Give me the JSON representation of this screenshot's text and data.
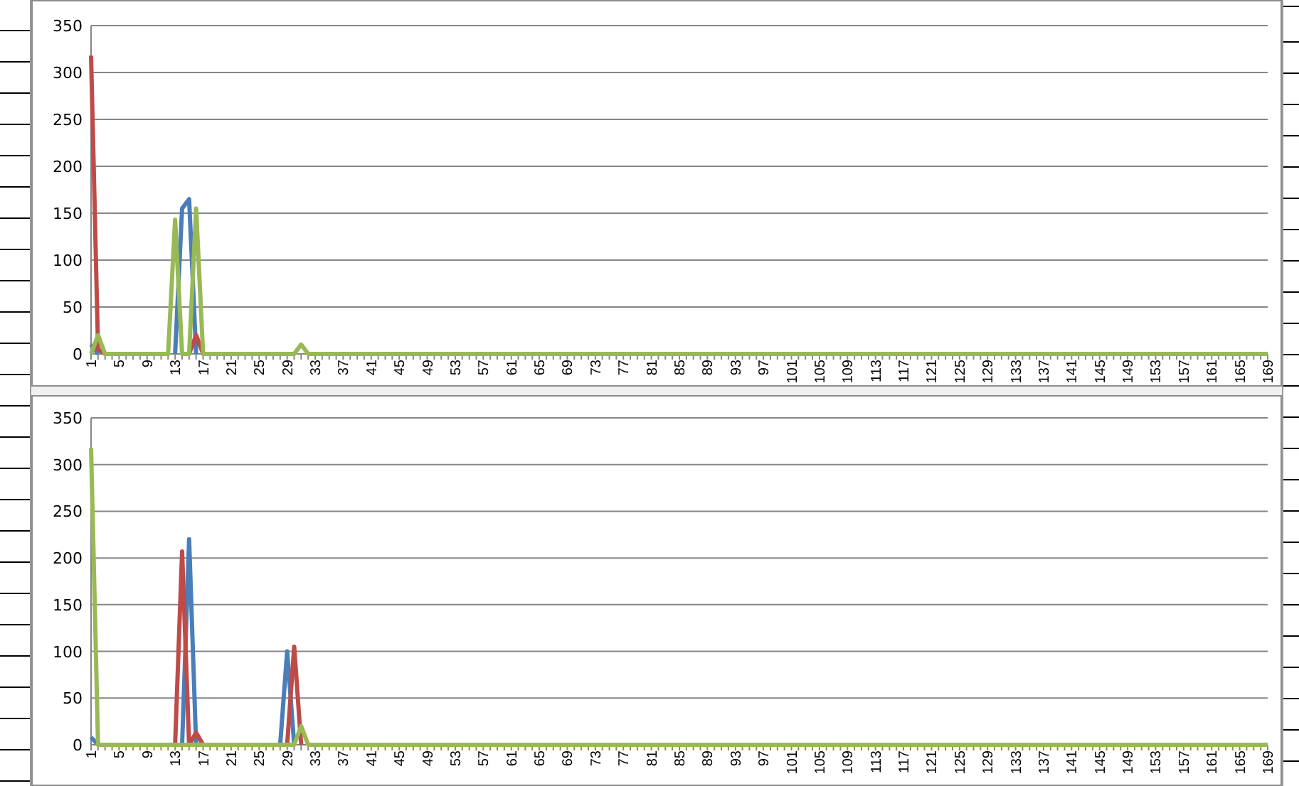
{
  "charts": [
    {
      "chart_data": {
        "type": "line",
        "x": [
          1,
          2,
          3,
          4,
          5,
          6,
          7,
          8,
          9,
          10,
          11,
          12,
          13,
          14,
          15,
          16,
          17,
          18,
          19,
          20,
          21,
          22,
          23,
          24,
          25,
          26,
          27,
          28,
          29,
          30,
          31,
          32,
          33,
          34,
          35,
          36,
          37,
          38,
          39,
          40,
          41,
          42,
          43,
          44,
          45,
          46,
          47,
          48,
          49,
          50,
          51,
          52,
          53,
          54,
          55,
          56,
          57,
          58,
          59,
          60,
          61,
          62,
          63,
          64,
          65,
          66,
          67,
          68,
          69,
          70,
          71,
          72,
          73,
          74,
          75,
          76,
          77,
          78,
          79,
          80,
          81,
          82,
          83,
          84,
          85,
          86,
          87,
          88,
          89,
          90,
          91,
          92,
          93,
          94,
          95,
          96,
          97,
          98,
          99,
          100,
          101,
          102,
          103,
          104,
          105,
          106,
          107,
          108,
          109,
          110,
          111,
          112,
          113,
          114,
          115,
          116,
          117,
          118,
          119,
          120,
          121,
          122,
          123,
          124,
          125,
          126,
          127,
          128,
          129,
          130,
          131,
          132,
          133,
          134,
          135,
          136,
          137,
          138,
          139,
          140,
          141,
          142,
          143,
          144,
          145,
          146,
          147,
          148,
          149,
          150,
          151,
          152,
          153,
          154,
          155,
          156,
          157,
          158,
          159,
          160,
          161,
          162,
          163,
          164,
          165,
          166,
          167,
          168,
          169
        ],
        "xlim": [
          1,
          169
        ],
        "xticks": [
          1,
          5,
          9,
          13,
          17,
          21,
          25,
          29,
          33,
          37,
          41,
          45,
          49,
          53,
          57,
          61,
          65,
          69,
          73,
          77,
          81,
          85,
          89,
          93,
          97,
          101,
          105,
          109,
          113,
          117,
          121,
          125,
          129,
          133,
          137,
          141,
          145,
          149,
          153,
          157,
          161,
          165,
          169
        ],
        "ylim": [
          0,
          350
        ],
        "yticks": [
          0,
          50,
          100,
          150,
          200,
          250,
          300,
          350
        ],
        "grid": true,
        "series": [
          {
            "color": "#4a7ebb",
            "values": [
              10,
              0,
              null,
              null,
              null,
              null,
              null,
              null,
              null,
              null,
              null,
              null,
              0,
              155,
              165,
              0,
              null,
              null,
              null,
              null,
              null,
              null,
              null,
              null,
              null,
              null,
              null,
              null,
              null,
              null,
              null,
              null,
              null,
              null,
              null,
              null,
              null,
              null,
              null,
              null,
              null,
              null,
              null,
              null,
              null,
              null,
              null,
              null,
              null,
              null,
              null,
              null,
              null,
              null,
              null,
              null,
              null,
              null,
              null,
              null,
              null,
              null,
              null,
              null,
              null,
              null,
              null,
              null,
              null,
              null,
              null,
              null,
              null,
              null,
              null,
              null,
              null,
              null,
              null,
              null,
              null,
              null,
              null,
              null,
              null,
              null,
              null,
              null,
              null,
              null,
              null,
              null,
              null,
              null,
              null,
              null,
              null,
              null,
              null,
              null,
              null,
              null,
              null,
              null,
              null,
              null,
              null,
              null,
              null,
              null,
              null,
              null,
              null,
              null,
              null,
              null,
              null,
              null,
              null,
              null,
              null,
              null,
              null,
              null,
              null,
              null,
              null,
              null,
              null,
              null,
              null,
              null,
              null,
              null,
              null,
              null,
              null,
              null,
              null,
              null,
              null,
              null,
              null,
              null,
              null,
              null,
              null,
              null,
              null,
              null,
              null,
              null,
              null,
              null,
              null,
              null,
              null,
              null,
              null,
              null,
              null,
              null,
              null,
              null,
              null,
              null,
              null,
              null,
              null
            ]
          },
          {
            "color": "#be4b48",
            "values": [
              318,
              5,
              0,
              null,
              null,
              null,
              null,
              null,
              null,
              null,
              null,
              null,
              null,
              null,
              0,
              20,
              0,
              null,
              null,
              null,
              null,
              null,
              null,
              null,
              null,
              null,
              null,
              null,
              null,
              null,
              null,
              null,
              null,
              null,
              null,
              null,
              null,
              null,
              null,
              null,
              null,
              null,
              null,
              null,
              null,
              null,
              null,
              null,
              null,
              null,
              null,
              null,
              null,
              null,
              null,
              null,
              null,
              null,
              null,
              null,
              null,
              null,
              null,
              null,
              null,
              null,
              null,
              null,
              null,
              null,
              null,
              null,
              null,
              null,
              null,
              null,
              null,
              null,
              null,
              null,
              null,
              null,
              null,
              null,
              null,
              null,
              null,
              null,
              null,
              null,
              null,
              null,
              null,
              null,
              null,
              null,
              null,
              null,
              null,
              null,
              null,
              null,
              null,
              null,
              null,
              null,
              null,
              null,
              null,
              null,
              null,
              null,
              null,
              null,
              null,
              null,
              null,
              null,
              null,
              null,
              null,
              null,
              null,
              null,
              null,
              null,
              null,
              null,
              null,
              null,
              null,
              null,
              null,
              null,
              null,
              null,
              null,
              null,
              null,
              null,
              null,
              null,
              null,
              null,
              null,
              null,
              null,
              null,
              null,
              null,
              null,
              null,
              null,
              null,
              null,
              null,
              null,
              null,
              null,
              null,
              null,
              null,
              null,
              null,
              null,
              null,
              null,
              null,
              null
            ]
          },
          {
            "color": "#98b954",
            "values": [
              0,
              20,
              0,
              0,
              0,
              0,
              0,
              0,
              0,
              0,
              0,
              0,
              143,
              0,
              0,
              155,
              0,
              0,
              0,
              0,
              0,
              0,
              0,
              0,
              0,
              0,
              0,
              0,
              0,
              0,
              10,
              0,
              0,
              0,
              0,
              0,
              0,
              0,
              0,
              0,
              0,
              0,
              0,
              0,
              0,
              0,
              0,
              0,
              0,
              0,
              0,
              0,
              0,
              0,
              0,
              0,
              0,
              0,
              0,
              0,
              0,
              0,
              0,
              0,
              0,
              0,
              0,
              0,
              0,
              0,
              0,
              0,
              0,
              0,
              0,
              0,
              0,
              0,
              0,
              0,
              0,
              0,
              0,
              0,
              0,
              0,
              0,
              0,
              0,
              0,
              0,
              0,
              0,
              0,
              0,
              0,
              0,
              0,
              0,
              0,
              0,
              0,
              0,
              0,
              0,
              0,
              0,
              0,
              0,
              0,
              0,
              0,
              0,
              0,
              0,
              0,
              0,
              0,
              0,
              0,
              0,
              0,
              0,
              0,
              0,
              0,
              0,
              0,
              0,
              0,
              0,
              0,
              0,
              0,
              0,
              0,
              0,
              0,
              0,
              0,
              0,
              0,
              0,
              0,
              0,
              0,
              0,
              0,
              0,
              0,
              0,
              0,
              0,
              0,
              0,
              0,
              0,
              0,
              0,
              0,
              0,
              0,
              0,
              0,
              0,
              0,
              0,
              0,
              0
            ]
          }
        ]
      }
    },
    {
      "chart_data": {
        "type": "line",
        "x": [
          1,
          2,
          3,
          4,
          5,
          6,
          7,
          8,
          9,
          10,
          11,
          12,
          13,
          14,
          15,
          16,
          17,
          18,
          19,
          20,
          21,
          22,
          23,
          24,
          25,
          26,
          27,
          28,
          29,
          30,
          31,
          32,
          33,
          34,
          35,
          36,
          37,
          38,
          39,
          40,
          41,
          42,
          43,
          44,
          45,
          46,
          47,
          48,
          49,
          50,
          51,
          52,
          53,
          54,
          55,
          56,
          57,
          58,
          59,
          60,
          61,
          62,
          63,
          64,
          65,
          66,
          67,
          68,
          69,
          70,
          71,
          72,
          73,
          74,
          75,
          76,
          77,
          78,
          79,
          80,
          81,
          82,
          83,
          84,
          85,
          86,
          87,
          88,
          89,
          90,
          91,
          92,
          93,
          94,
          95,
          96,
          97,
          98,
          99,
          100,
          101,
          102,
          103,
          104,
          105,
          106,
          107,
          108,
          109,
          110,
          111,
          112,
          113,
          114,
          115,
          116,
          117,
          118,
          119,
          120,
          121,
          122,
          123,
          124,
          125,
          126,
          127,
          128,
          129,
          130,
          131,
          132,
          133,
          134,
          135,
          136,
          137,
          138,
          139,
          140,
          141,
          142,
          143,
          144,
          145,
          146,
          147,
          148,
          149,
          150,
          151,
          152,
          153,
          154,
          155,
          156,
          157,
          158,
          159,
          160,
          161,
          162,
          163,
          164,
          165,
          166,
          167,
          168,
          169
        ],
        "xlim": [
          1,
          169
        ],
        "xticks": [
          1,
          5,
          9,
          13,
          17,
          21,
          25,
          29,
          33,
          37,
          41,
          45,
          49,
          53,
          57,
          61,
          65,
          69,
          73,
          77,
          81,
          85,
          89,
          93,
          97,
          101,
          105,
          109,
          113,
          117,
          121,
          125,
          129,
          133,
          137,
          141,
          145,
          149,
          153,
          157,
          161,
          165,
          169
        ],
        "ylim": [
          0,
          350
        ],
        "yticks": [
          0,
          50,
          100,
          150,
          200,
          250,
          300,
          350
        ],
        "grid": true,
        "series": [
          {
            "color": "#4a7ebb",
            "values": [
              8,
              0,
              null,
              null,
              null,
              null,
              null,
              null,
              null,
              null,
              null,
              null,
              null,
              0,
              220,
              0,
              null,
              null,
              null,
              null,
              null,
              null,
              null,
              null,
              null,
              null,
              null,
              0,
              100,
              0,
              null,
              null,
              null,
              null,
              null,
              null,
              null,
              null,
              null,
              null,
              null,
              null,
              null,
              null,
              null,
              null,
              null,
              null,
              null,
              null,
              null,
              null,
              null,
              null,
              null,
              null,
              null,
              null,
              null,
              null,
              null,
              null,
              null,
              null,
              null,
              null,
              null,
              null,
              null,
              null,
              null,
              null,
              null,
              null,
              null,
              null,
              null,
              null,
              null,
              null,
              null,
              null,
              null,
              null,
              null,
              null,
              null,
              null,
              null,
              null,
              null,
              null,
              null,
              null,
              null,
              null,
              null,
              null,
              null,
              null,
              null,
              null,
              null,
              null,
              null,
              null,
              null,
              null,
              null,
              null,
              null,
              null,
              null,
              null,
              null,
              null,
              null,
              null,
              null,
              null,
              null,
              null,
              null,
              null,
              null,
              null,
              null,
              null,
              null,
              null,
              null,
              null,
              null,
              null,
              null,
              null,
              null,
              null,
              null,
              null,
              null,
              null,
              null,
              null,
              null,
              null,
              null,
              null,
              null,
              null,
              null,
              null,
              null,
              null,
              null,
              null,
              null,
              null,
              null,
              null,
              null,
              null,
              null,
              null,
              null,
              null,
              null,
              null,
              null
            ]
          },
          {
            "color": "#be4b48",
            "values": [
              null,
              null,
              null,
              null,
              null,
              null,
              null,
              null,
              null,
              null,
              null,
              null,
              0,
              207,
              0,
              13,
              0,
              null,
              null,
              null,
              null,
              null,
              null,
              null,
              null,
              null,
              null,
              null,
              0,
              105,
              0,
              null,
              null,
              null,
              null,
              null,
              null,
              null,
              null,
              null,
              null,
              null,
              null,
              null,
              null,
              null,
              null,
              null,
              null,
              null,
              null,
              null,
              null,
              null,
              null,
              null,
              null,
              null,
              null,
              null,
              null,
              null,
              null,
              null,
              null,
              null,
              null,
              null,
              null,
              null,
              null,
              null,
              null,
              null,
              null,
              null,
              null,
              null,
              null,
              null,
              null,
              null,
              null,
              null,
              null,
              null,
              null,
              null,
              null,
              null,
              null,
              null,
              null,
              null,
              null,
              null,
              null,
              null,
              null,
              null,
              null,
              null,
              null,
              null,
              null,
              null,
              null,
              null,
              null,
              null,
              null,
              null,
              null,
              null,
              null,
              null,
              null,
              null,
              null,
              null,
              null,
              null,
              null,
              null,
              null,
              null,
              null,
              null,
              null,
              null,
              null,
              null,
              null,
              null,
              null,
              null,
              null,
              null,
              null,
              null,
              null,
              null,
              null,
              null,
              null,
              null,
              null,
              null,
              null,
              null,
              null,
              null,
              null,
              null,
              null,
              null,
              null,
              null,
              null,
              null,
              null,
              null,
              null,
              null,
              null,
              null,
              null,
              null,
              null
            ]
          },
          {
            "color": "#98b954",
            "values": [
              318,
              0,
              0,
              0,
              0,
              0,
              0,
              0,
              0,
              0,
              0,
              0,
              0,
              0,
              0,
              0,
              0,
              0,
              0,
              0,
              0,
              0,
              0,
              0,
              0,
              0,
              0,
              0,
              0,
              0,
              20,
              0,
              0,
              0,
              0,
              0,
              0,
              0,
              0,
              0,
              0,
              0,
              0,
              0,
              0,
              0,
              0,
              0,
              0,
              0,
              0,
              0,
              0,
              0,
              0,
              0,
              0,
              0,
              0,
              0,
              0,
              0,
              0,
              0,
              0,
              0,
              0,
              0,
              0,
              0,
              0,
              0,
              0,
              0,
              0,
              0,
              0,
              0,
              0,
              0,
              0,
              0,
              0,
              0,
              0,
              0,
              0,
              0,
              0,
              0,
              0,
              0,
              0,
              0,
              0,
              0,
              0,
              0,
              0,
              0,
              0,
              0,
              0,
              0,
              0,
              0,
              0,
              0,
              0,
              0,
              0,
              0,
              0,
              0,
              0,
              0,
              0,
              0,
              0,
              0,
              0,
              0,
              0,
              0,
              0,
              0,
              0,
              0,
              0,
              0,
              0,
              0,
              0,
              0,
              0,
              0,
              0,
              0,
              0,
              0,
              0,
              0,
              0,
              0,
              0,
              0,
              0,
              0,
              0,
              0,
              0,
              0,
              0,
              0,
              0,
              0,
              0,
              0,
              0,
              0,
              0,
              0,
              0,
              0,
              0,
              0,
              0,
              0,
              0
            ]
          }
        ]
      }
    }
  ]
}
